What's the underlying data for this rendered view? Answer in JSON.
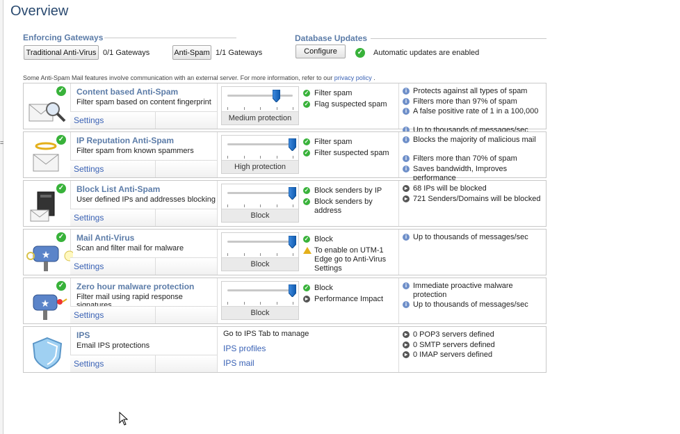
{
  "page": {
    "title": "Overview"
  },
  "enforcing": {
    "heading": "Enforcing Gateways",
    "antivirus_button": "Traditional Anti-Virus",
    "antivirus_count": "0/1 Gateways",
    "antispam_button": "Anti-Spam",
    "antispam_count": "1/1 Gateways"
  },
  "database": {
    "heading": "Database Updates",
    "configure_button": "Configure",
    "status": "Automatic updates are enabled"
  },
  "note": {
    "text": "Some Anti-Spam Mail features involve communication with an external server. For more information, refer to our",
    "link": "privacy policy",
    "suffix": "."
  },
  "rows": [
    {
      "title": "Content based Anti-Spam",
      "desc": "Filter spam based on content fingerprint",
      "settings": "Settings",
      "level_label": "Medium protection",
      "level_fraction": 0.75,
      "checks": [
        "Filter spam",
        "Flag suspected spam"
      ],
      "bullets": [
        "Protects against all types of spam",
        "Filters more than 97% of spam",
        "A false positive rate of 1 in a 100,000",
        "Up to thousands of messages/sec"
      ]
    },
    {
      "title": "IP Reputation Anti-Spam",
      "desc": "Filter spam from known spammers",
      "settings": "Settings",
      "level_label": "High protection",
      "level_fraction": 1.0,
      "checks": [
        "Filter spam",
        "Filter suspected spam"
      ],
      "bullets": [
        "Blocks the majority of malicious mail",
        "Filters more than 70% of spam",
        "Saves bandwidth, Improves performance"
      ]
    },
    {
      "title": "Block List Anti-Spam",
      "desc": "User defined IPs and addresses blocking",
      "settings": "Settings",
      "level_label": "Block",
      "level_fraction": 1.0,
      "checks": [
        "Block senders by IP",
        "Block senders by address"
      ],
      "bullets": [
        "68 IPs will be blocked",
        "721 Senders/Domains will be blocked"
      ]
    },
    {
      "title": "Mail Anti-Virus",
      "desc": "Scan and filter mail for malware",
      "settings": "Settings",
      "level_label": "Block",
      "level_fraction": 1.0,
      "checks": [
        "Block",
        "To enable on UTM-1 Edge go to Anti-Virus Settings"
      ],
      "bullets": [
        "Up to thousands of messages/sec"
      ]
    },
    {
      "title": "Zero hour malware protection",
      "desc": "Filter mail using rapid response signatures",
      "settings": "Settings",
      "level_label": "Block",
      "level_fraction": 1.0,
      "checks": [
        "Block",
        "Performance Impact"
      ],
      "bullets": [
        "Immediate proactive malware protection",
        "Up to thousands of messages/sec"
      ]
    },
    {
      "title": "IPS",
      "desc": "Email IPS protections",
      "settings": "Settings",
      "ips_text": "Go to IPS Tab to manage",
      "ips_link1": "IPS profiles",
      "ips_link2": "IPS mail",
      "bullets": [
        "0 POP3 servers defined",
        "0 SMTP servers defined",
        "0 IMAP servers defined"
      ]
    }
  ],
  "icons": {
    "ok": "green-check-icon",
    "info": "info-icon",
    "arrow": "dark-arrow-icon",
    "warn": "warning-icon"
  },
  "colors": {
    "heading": "#5c7ca8",
    "link": "#3a62b5",
    "ok": "#38b23a",
    "thumb": "#1d6fc2"
  }
}
